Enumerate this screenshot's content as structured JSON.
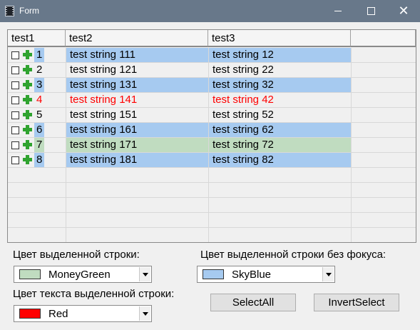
{
  "window": {
    "title": "Form",
    "minimize_icon": "minimize-icon",
    "maximize_icon": "maximize-icon",
    "close_icon": "close-icon",
    "close_glyph": "✕"
  },
  "grid": {
    "columns": [
      "test1",
      "test2",
      "test3",
      ""
    ],
    "rows": [
      {
        "num": "1",
        "col2": "test string 111",
        "col3": "test string 12",
        "style": "selected"
      },
      {
        "num": "2",
        "col2": "test string 121",
        "col3": "test string 22",
        "style": "normal"
      },
      {
        "num": "3",
        "col2": "test string 131",
        "col3": "test string 32",
        "style": "selected"
      },
      {
        "num": "4",
        "col2": "test string 141",
        "col3": "test string 42",
        "style": "red-text"
      },
      {
        "num": "5",
        "col2": "test string 151",
        "col3": "test string 52",
        "style": "normal"
      },
      {
        "num": "6",
        "col2": "test string 161",
        "col3": "test string 62",
        "style": "selected"
      },
      {
        "num": "7",
        "col2": "test string 171",
        "col3": "test string 72",
        "style": "current"
      },
      {
        "num": "8",
        "col2": "test string 181",
        "col3": "test string 82",
        "style": "selected"
      }
    ],
    "empty_rows": 5
  },
  "controls": {
    "selected_row_color_label": "Цвет выделенной строки:",
    "selected_row_color": {
      "value": "MoneyGreen",
      "swatch": "#c0dcc0"
    },
    "unfocused_color_label": "Цвет выделенной строки без фокуса:",
    "unfocused_color": {
      "value": "SkyBlue",
      "swatch": "#a6caf0"
    },
    "text_color_label": "Цвет текста выделенной строки:",
    "text_color": {
      "value": "Red",
      "swatch": "#ff0000"
    },
    "select_all_label": "SelectAll",
    "invert_select_label": "InvertSelect"
  },
  "colors": {
    "sky_blue": "#a6caf0",
    "money_green": "#c0dcc0",
    "red_text": "#ff0000",
    "row_bg": "#f0f0f0"
  }
}
